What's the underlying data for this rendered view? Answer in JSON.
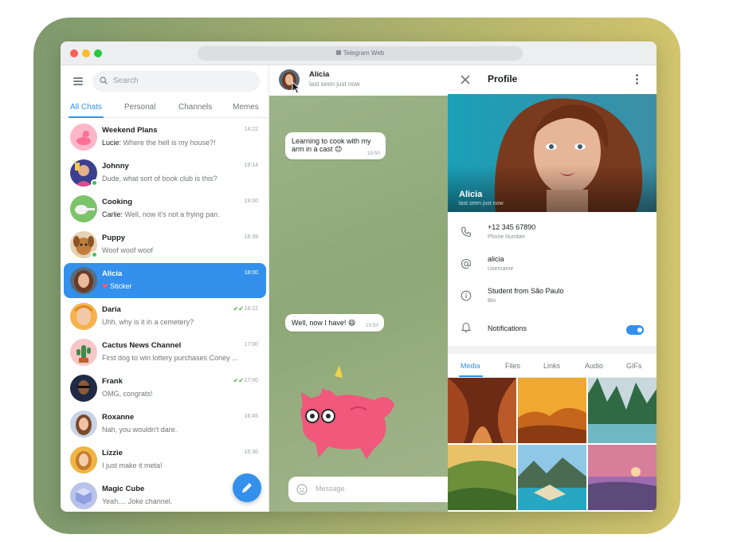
{
  "window": {
    "url": "Telegram Web"
  },
  "colors": {
    "accent": "#3390ec",
    "online": "#3fc255",
    "read_check": "#4fae4e"
  },
  "search": {
    "placeholder": "Search"
  },
  "tabs": [
    {
      "label": "All Chats",
      "active": true
    },
    {
      "label": "Personal"
    },
    {
      "label": "Channels"
    },
    {
      "label": "Memes"
    }
  ],
  "chats": [
    {
      "name": "Weekend Plans",
      "sender": "Lucie:",
      "text": "Where the hell is my house?!",
      "time": "14:22"
    },
    {
      "name": "Johnny",
      "sender": "",
      "text": "Dude, what sort of book club is this?",
      "time": "19:14"
    },
    {
      "name": "Cooking",
      "sender": "Carlie:",
      "text": "Well, now it's not a frying pan.",
      "time": "19:00"
    },
    {
      "name": "Puppy",
      "sender": "",
      "text": "Woof woof woof",
      "time": "18:39"
    },
    {
      "name": "Alicia",
      "sender": "",
      "text": "Sticker",
      "time": "18:00",
      "active": true
    },
    {
      "name": "Daria",
      "sender": "",
      "text": "Uhh, why is it in a cemetery?",
      "time": "18:22"
    },
    {
      "name": "Cactus News Channel",
      "sender": "",
      "text": "First dog to win lottery purchases Coney ...",
      "time": "17:00"
    },
    {
      "name": "Frank",
      "sender": "",
      "text": "OMG, congrats!",
      "time": "17:00"
    },
    {
      "name": "Roxanne",
      "sender": "",
      "text": "Nah, you wouldn't dare.",
      "time": "16:45"
    },
    {
      "name": "Lizzie",
      "sender": "",
      "text": "I just make it meta!",
      "time": "16:30"
    },
    {
      "name": "Magic Cube",
      "sender": "",
      "text": "Yeah.... Joke channel.",
      "time": ""
    }
  ],
  "conversation": {
    "name": "Alicia",
    "status": "last seen just now",
    "messages": [
      {
        "line1": "Learning to cook with my",
        "line2": "arm in a cast 😊",
        "time": "19:50"
      },
      {
        "line1": "Well, now I have! 😄",
        "line2": "",
        "time": "19:50"
      }
    ],
    "input_placeholder": "Message"
  },
  "profile": {
    "title": "Profile",
    "name": "Alicia",
    "status": "last seen just now",
    "phone": {
      "value": "+12 345 67890",
      "label": "Phone Number"
    },
    "username": {
      "value": "alicia",
      "label": "Username"
    },
    "bio": {
      "value": "Student from São Paulo",
      "label": "Bio"
    },
    "notifications": {
      "label": "Notifications",
      "enabled": true
    },
    "media_tabs": [
      {
        "label": "Media",
        "active": true
      },
      {
        "label": "Files"
      },
      {
        "label": "Links"
      },
      {
        "label": "Audio"
      },
      {
        "label": "GIFs"
      }
    ]
  }
}
